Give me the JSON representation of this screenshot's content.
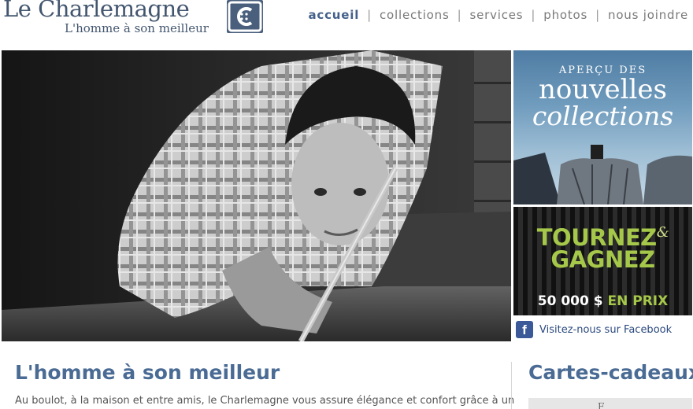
{
  "brand": {
    "name": "Le Charlemagne",
    "tagline": "L'homme à son meilleur",
    "logo_letter": "C"
  },
  "nav": {
    "items": [
      {
        "label": "accueil",
        "active": true
      },
      {
        "label": "collections"
      },
      {
        "label": "services"
      },
      {
        "label": "photos"
      },
      {
        "label": "nous joindre"
      }
    ],
    "separator": "|"
  },
  "promo_collections": {
    "line1": "APERÇU DES",
    "line2": "nouvelles",
    "line3": "collections"
  },
  "promo_contest": {
    "line1": "TOURNEZ",
    "amp": "&",
    "line2": "GAGNEZ",
    "prize_amount": "50 000 $",
    "prize_label": "EN PRIX"
  },
  "facebook": {
    "icon_letter": "f",
    "label": "Visitez-nous sur Facebook"
  },
  "main": {
    "title": "L'homme à son meilleur",
    "paragraph": "Au boulot, à la maison et entre amis, le Charlemagne vous assure élégance et confort grâce à un"
  },
  "sidebar": {
    "title": "Cartes-cadeaux",
    "box_glyph": "F"
  },
  "colors": {
    "brand_blue": "#43566f",
    "accent_green": "#a6c84a",
    "facebook_blue": "#3b5998"
  }
}
